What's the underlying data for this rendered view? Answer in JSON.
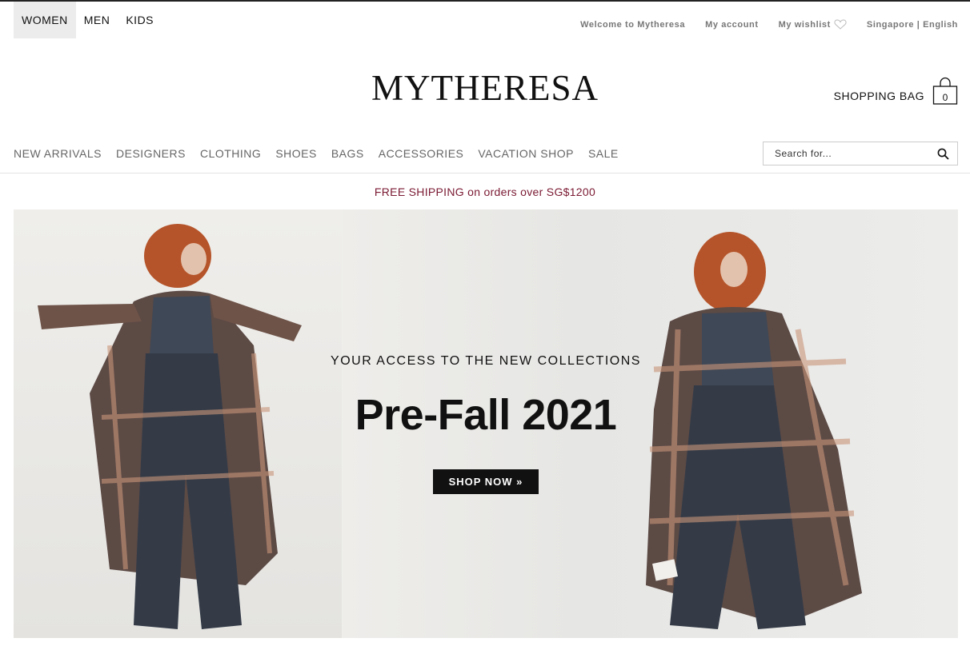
{
  "departments": [
    {
      "label": "WOMEN",
      "active": true
    },
    {
      "label": "MEN",
      "active": false
    },
    {
      "label": "KIDS",
      "active": false
    }
  ],
  "utility": {
    "welcome": "Welcome to Mytheresa",
    "account": "My account",
    "wishlist": "My wishlist",
    "region": "Singapore | English"
  },
  "logo": "MYTHERESA",
  "bag": {
    "label": "SHOPPING BAG",
    "count": "0"
  },
  "nav": [
    "NEW ARRIVALS",
    "DESIGNERS",
    "CLOTHING",
    "SHOES",
    "BAGS",
    "ACCESSORIES",
    "VACATION SHOP",
    "SALE"
  ],
  "search": {
    "placeholder": "Search for..."
  },
  "promo": "FREE SHIPPING on orders over SG$1200",
  "hero": {
    "kicker": "YOUR ACCESS TO THE NEW COLLECTIONS",
    "title": "Pre-Fall 2021",
    "cta": "SHOP NOW »"
  },
  "colors": {
    "promo": "#7a1a33",
    "cta_bg": "#111111",
    "nav_text": "#666666"
  }
}
